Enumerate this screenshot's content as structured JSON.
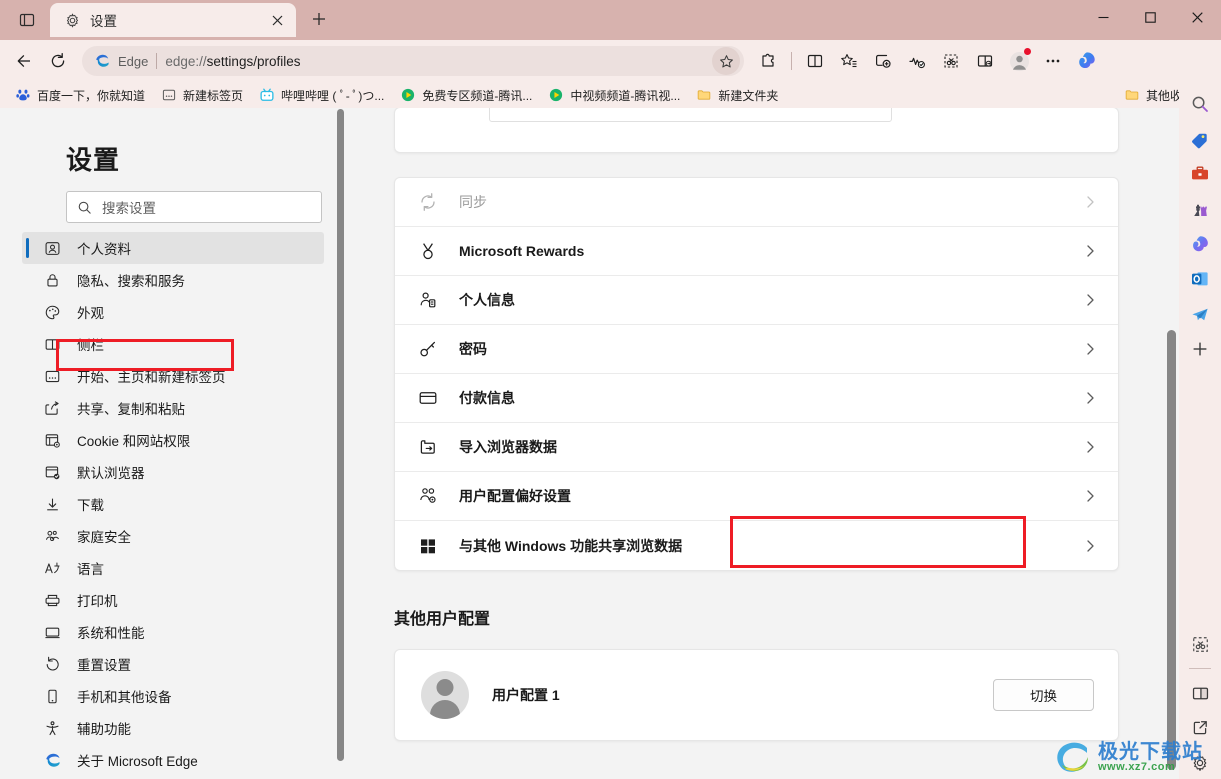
{
  "window": {
    "title": "设置",
    "controls": {
      "minimize": "—",
      "maximize": "□",
      "close": "✕"
    }
  },
  "tabbar": {
    "tab_search_icon": "tab-search-icon",
    "tab": {
      "favicon": "settings-gear-icon",
      "title": "设置",
      "close_label": "✕"
    },
    "new_tab_label": "+"
  },
  "toolbar": {
    "back_icon": "back-arrow-icon",
    "refresh_icon": "refresh-icon",
    "omnibox": {
      "brand": "Edge",
      "url_scheme": "edge://",
      "url_path": "settings/profiles",
      "url_full": "edge://settings/profiles",
      "star_icon": "favorite-star-icon"
    },
    "icons": [
      {
        "name": "extensions-icon"
      },
      {
        "name": "split-screen-icon"
      },
      {
        "name": "favorites-icon"
      },
      {
        "name": "collections-icon"
      },
      {
        "name": "browser-essentials-icon"
      },
      {
        "name": "screenshot-icon"
      },
      {
        "name": "split-window-icon"
      }
    ],
    "profile_icon": "profile-avatar-icon",
    "more_icon": "more-options-icon",
    "copilot_icon": "copilot-icon"
  },
  "bookmarks": [
    {
      "label": "百度一下，你就知道",
      "icon": "baidu-favicon"
    },
    {
      "label": "新建标签页",
      "icon": "newtab-favicon"
    },
    {
      "label": "哔哩哔哩 ( ﾟ- ﾟ)つ...",
      "icon": "bilibili-favicon"
    },
    {
      "label": "免费专区频道-腾讯...",
      "icon": "tencent-video-favicon"
    },
    {
      "label": "中视频频道-腾讯视...",
      "icon": "tencent-video-favicon"
    },
    {
      "label": "新建文件夹",
      "icon": "folder-icon"
    }
  ],
  "bookmarks_right": {
    "label": "其他收藏夹",
    "icon": "folder-icon"
  },
  "edgebar": [
    {
      "name": "search-icon"
    },
    {
      "name": "shopping-tag-icon"
    },
    {
      "name": "tools-briefcase-icon"
    },
    {
      "name": "games-chess-icon"
    },
    {
      "name": "copilot-icon"
    },
    {
      "name": "outlook-icon"
    },
    {
      "name": "telegram-plane-icon"
    },
    {
      "name": "add-sidebar-icon"
    }
  ],
  "edgebar_bottom": [
    {
      "name": "screenshot-icon"
    },
    {
      "name": "split-screen-icon"
    },
    {
      "name": "open-external-icon"
    },
    {
      "name": "settings-gear-icon"
    }
  ],
  "settings": {
    "title": "设置",
    "search": {
      "placeholder": "搜索设置",
      "icon": "search-icon"
    },
    "nav_items": [
      {
        "label": "个人资料",
        "icon": "profile-icon",
        "selected": true
      },
      {
        "label": "隐私、搜索和服务",
        "icon": "lock-icon",
        "selected": false
      },
      {
        "label": "外观",
        "icon": "palette-icon",
        "selected": false
      },
      {
        "label": "侧栏",
        "icon": "sidebar-icon",
        "selected": false
      },
      {
        "label": "开始、主页和新建标签页",
        "icon": "home-icon",
        "selected": false
      },
      {
        "label": "共享、复制和粘贴",
        "icon": "share-icon",
        "selected": false
      },
      {
        "label": "Cookie 和网站权限",
        "icon": "cookie-icon",
        "selected": false
      },
      {
        "label": "默认浏览器",
        "icon": "default-browser-icon",
        "selected": false
      },
      {
        "label": "下载",
        "icon": "download-icon",
        "selected": false
      },
      {
        "label": "家庭安全",
        "icon": "family-icon",
        "selected": false
      },
      {
        "label": "语言",
        "icon": "language-icon",
        "selected": false
      },
      {
        "label": "打印机",
        "icon": "printer-icon",
        "selected": false
      },
      {
        "label": "系统和性能",
        "icon": "system-icon",
        "selected": false
      },
      {
        "label": "重置设置",
        "icon": "reset-icon",
        "selected": false
      },
      {
        "label": "手机和其他设备",
        "icon": "phone-icon",
        "selected": false
      },
      {
        "label": "辅助功能",
        "icon": "accessibility-icon",
        "selected": false
      },
      {
        "label": "关于 Microsoft Edge",
        "icon": "edge-logo-icon",
        "selected": false
      }
    ],
    "rows": [
      {
        "label": "同步",
        "icon": "sync-icon",
        "dim": true
      },
      {
        "label": "Microsoft Rewards",
        "icon": "rewards-medal-icon",
        "dim": false
      },
      {
        "label": "个人信息",
        "icon": "personal-info-icon",
        "dim": false
      },
      {
        "label": "密码",
        "icon": "key-icon",
        "dim": false
      },
      {
        "label": "付款信息",
        "icon": "credit-card-icon",
        "dim": false
      },
      {
        "label": "导入浏览器数据",
        "icon": "import-data-icon",
        "dim": false,
        "highlighted": true
      },
      {
        "label": "用户配置偏好设置",
        "icon": "user-prefs-icon",
        "dim": false
      },
      {
        "label": "与其他 Windows 功能共享浏览数据",
        "icon": "windows-logo-icon",
        "dim": false
      }
    ],
    "other_profiles": {
      "section_title": "其他用户配置",
      "profile": {
        "name": "用户配置 1",
        "avatar": "default-avatar-icon",
        "switch_label": "切换"
      }
    }
  },
  "watermark": {
    "top": "极光下载站",
    "bottom": "www.xz7.com"
  },
  "colors": {
    "titlebar": "#d7b2ae",
    "chrome": "#f7ecea",
    "accent": "#0f6cbd",
    "highlight": "#ee1c25",
    "page_bg": "#f3f3f3",
    "card": "#ffffff"
  }
}
